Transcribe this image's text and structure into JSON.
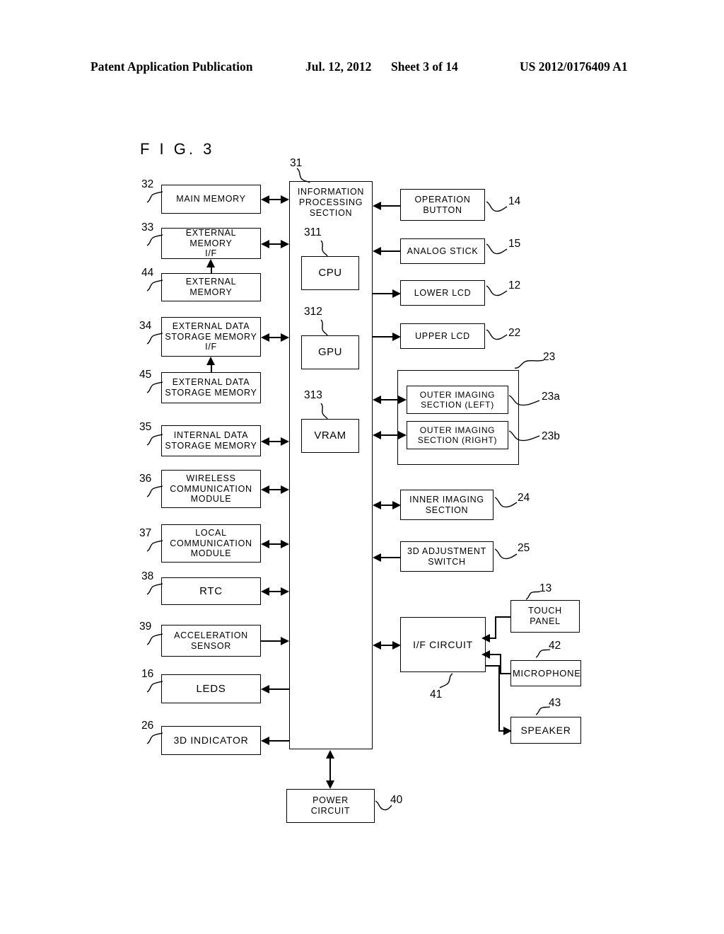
{
  "header": {
    "publication": "Patent Application Publication",
    "date": "Jul. 12, 2012",
    "sheet": "Sheet 3 of 14",
    "pub_number": "US 2012/0176409 A1"
  },
  "figure": {
    "title": "F I G.  3"
  },
  "blocks": {
    "information_processing_section": {
      "label": "INFORMATION\nPROCESSING\nSECTION",
      "ref": "31"
    },
    "cpu": {
      "label": "CPU",
      "ref": "311"
    },
    "gpu": {
      "label": "GPU",
      "ref": "312"
    },
    "vram": {
      "label": "VRAM",
      "ref": "313"
    },
    "main_memory": {
      "label": "MAIN MEMORY",
      "ref": "32"
    },
    "external_memory_if": {
      "label": "EXTERNAL MEMORY\nI/F",
      "ref": "33"
    },
    "external_memory": {
      "label": "EXTERNAL MEMORY",
      "ref": "44"
    },
    "external_data_storage_memory_if": {
      "label": "EXTERNAL DATA\nSTORAGE MEMORY\nI/F",
      "ref": "34"
    },
    "external_data_storage_memory": {
      "label": "EXTERNAL DATA\nSTORAGE MEMORY",
      "ref": "45"
    },
    "internal_data_storage_memory": {
      "label": "INTERNAL DATA\nSTORAGE MEMORY",
      "ref": "35"
    },
    "wireless_communication_module": {
      "label": "WIRELESS\nCOMMUNICATION\nMODULE",
      "ref": "36"
    },
    "local_communication_module": {
      "label": "LOCAL\nCOMMUNICATION\nMODULE",
      "ref": "37"
    },
    "rtc": {
      "label": "RTC",
      "ref": "38"
    },
    "acceleration_sensor": {
      "label": "ACCELERATION\nSENSOR",
      "ref": "39"
    },
    "leds": {
      "label": "LEDS",
      "ref": "16"
    },
    "indicator_3d": {
      "label": "3D INDICATOR",
      "ref": "26"
    },
    "operation_button": {
      "label": "OPERATION\nBUTTON",
      "ref": "14"
    },
    "analog_stick": {
      "label": "ANALOG STICK",
      "ref": "15"
    },
    "lower_lcd": {
      "label": "LOWER LCD",
      "ref": "12"
    },
    "upper_lcd": {
      "label": "UPPER LCD",
      "ref": "22"
    },
    "outer_imaging_group": {
      "label": "",
      "ref": "23"
    },
    "outer_imaging_left": {
      "label": "OUTER IMAGING\nSECTION (LEFT)",
      "ref": "23a"
    },
    "outer_imaging_right": {
      "label": "OUTER IMAGING\nSECTION (RIGHT)",
      "ref": "23b"
    },
    "inner_imaging_section": {
      "label": "INNER IMAGING\nSECTION",
      "ref": "24"
    },
    "adjustment_switch_3d": {
      "label": "3D ADJUSTMENT\nSWITCH",
      "ref": "25"
    },
    "if_circuit": {
      "label": "I/F CIRCUIT",
      "ref": "41"
    },
    "touch_panel": {
      "label": "TOUCH\nPANEL",
      "ref": "13"
    },
    "microphone": {
      "label": "MICROPHONE",
      "ref": "42"
    },
    "speaker": {
      "label": "SPEAKER",
      "ref": "43"
    },
    "power_circuit": {
      "label": "POWER\nCIRCUIT",
      "ref": "40"
    }
  },
  "colors": {
    "ink": "#000000",
    "paper": "#ffffff"
  }
}
